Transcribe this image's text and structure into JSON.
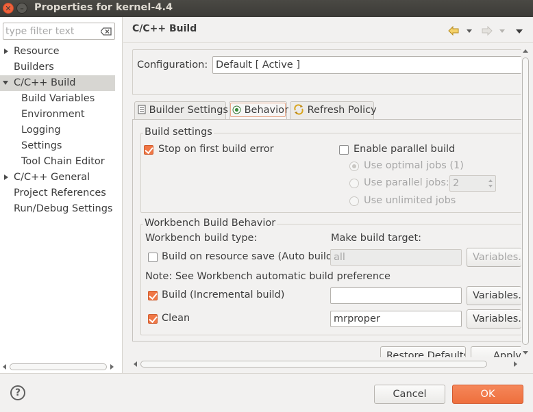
{
  "window": {
    "title": "Properties for kernel-4.4"
  },
  "filter": {
    "placeholder": "type filter text"
  },
  "tree": {
    "items": [
      {
        "label": "Resource"
      },
      {
        "label": "Builders"
      },
      {
        "label": "C/C++ Build"
      },
      {
        "label": "Build Variables"
      },
      {
        "label": "Environment"
      },
      {
        "label": "Logging"
      },
      {
        "label": "Settings"
      },
      {
        "label": "Tool Chain Editor"
      },
      {
        "label": "C/C++ General"
      },
      {
        "label": "Project References"
      },
      {
        "label": "Run/Debug Settings"
      }
    ]
  },
  "page": {
    "title": "C/C++ Build"
  },
  "configuration": {
    "label": "Configuration:",
    "value": "Default  [ Active ]"
  },
  "tabs": [
    {
      "label": "Builder Settings",
      "icon": "builder-settings-icon"
    },
    {
      "label": "Behavior",
      "icon": "behavior-icon",
      "active": true
    },
    {
      "label": "Refresh Policy",
      "icon": "refresh-icon"
    }
  ],
  "build_settings": {
    "legend": "Build settings",
    "stop_on_first_error": {
      "label": "Stop on first build error",
      "checked": true
    },
    "enable_parallel": {
      "label": "Enable parallel build",
      "checked": false
    },
    "use_optimal_jobs": {
      "label": "Use optimal jobs (1)",
      "selected": true
    },
    "use_parallel_jobs": {
      "label": "Use parallel jobs:",
      "value": "2"
    },
    "use_unlimited_jobs": {
      "label": "Use unlimited jobs"
    }
  },
  "workbench": {
    "legend": "Workbench Build Behavior",
    "build_type_label": "Workbench build type:",
    "make_target_label": "Make build target:",
    "auto_build": {
      "label": "Build on resource save (Auto build)",
      "checked": false,
      "target": "all"
    },
    "note": "Note: See Workbench automatic build preference",
    "incremental": {
      "label": "Build (Incremental build)",
      "checked": true,
      "target": ""
    },
    "clean": {
      "label": "Clean",
      "checked": true,
      "target": "mrproper"
    },
    "variables_label": "Variables..."
  },
  "buttons": {
    "restore_defaults": "Restore Defaults",
    "apply": "Apply",
    "cancel": "Cancel",
    "ok": "OK",
    "help": "?"
  },
  "colors": {
    "accent": "#f07746",
    "titlebar": "#3c3b37"
  }
}
